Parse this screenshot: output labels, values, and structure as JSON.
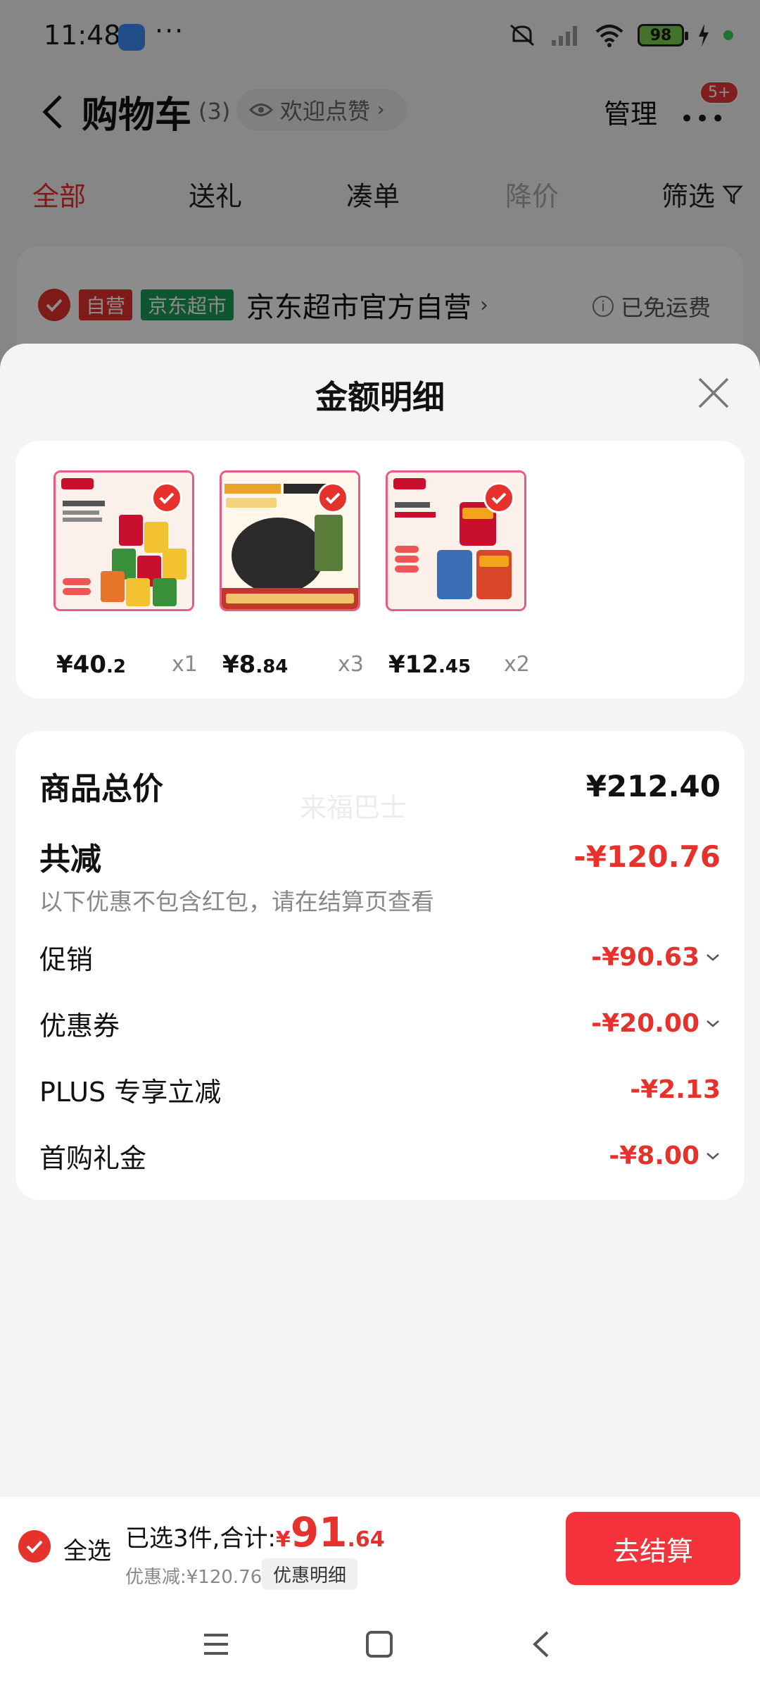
{
  "status_bar": {
    "time": "11:48",
    "battery": "98"
  },
  "nav": {
    "title": "购物车",
    "count": "(3)",
    "like_label": "欢迎点赞",
    "manage": "管理",
    "badge": "5+"
  },
  "tabs": [
    "全部",
    "送礼",
    "凑单",
    "降价",
    "筛选"
  ],
  "shop": {
    "tag_self": "自营",
    "tag_market": "京东超市",
    "name": "京东超市官方自营",
    "shipping": "已免运费"
  },
  "sheet": {
    "title": "金额明细",
    "products": [
      {
        "price_int": "¥40",
        "price_dec": ".2",
        "qty": "x1",
        "colors": [
          "#c8102e",
          "#f2c230",
          "#3a8f3a"
        ]
      },
      {
        "price_int": "¥8",
        "price_dec": ".84",
        "qty": "x3",
        "colors": [
          "#2b2b2b",
          "#e8a42a",
          "#c0392b"
        ]
      },
      {
        "price_int": "¥12",
        "price_dec": ".45",
        "qty": "x2",
        "colors": [
          "#c8102e",
          "#f2a51a",
          "#3b6fb5"
        ]
      }
    ],
    "summary": {
      "total_label": "商品总价",
      "total_value": "¥212.40",
      "reduce_label": "共减",
      "reduce_value": "-¥120.76",
      "reduce_note": "以下优惠不包含红包，请在结算页查看",
      "items": [
        {
          "label": "促销",
          "value": "-¥90.63",
          "expandable": true
        },
        {
          "label": "优惠券",
          "value": "-¥20.00",
          "expandable": true
        },
        {
          "label": "PLUS 专享立减",
          "value": "-¥2.13",
          "expandable": false
        },
        {
          "label": "首购礼金",
          "value": "-¥8.00",
          "expandable": true
        }
      ],
      "watermark": "来福巴士"
    }
  },
  "checkout": {
    "select_all": "全选",
    "selected_text": "已选3件,合计:",
    "yen": "¥",
    "total_int": "91",
    "total_dec": ".64",
    "discount": "优惠减:¥120.76",
    "detail_button": "优惠明细",
    "pay_button": "去结算"
  },
  "colors": {
    "accent": "#e5322d",
    "button": "#f3323b",
    "green_tag": "#1a9d57"
  }
}
